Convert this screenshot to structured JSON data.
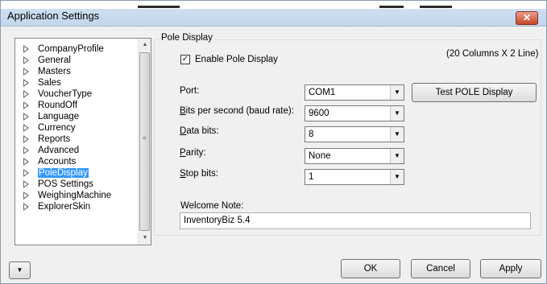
{
  "window": {
    "title": "Application Settings",
    "close_label": "✕"
  },
  "nav": {
    "items": [
      {
        "label": "CompanyProfile"
      },
      {
        "label": "General"
      },
      {
        "label": "Masters"
      },
      {
        "label": "Sales"
      },
      {
        "label": "VoucherType"
      },
      {
        "label": "RoundOff"
      },
      {
        "label": "Language"
      },
      {
        "label": "Currency"
      },
      {
        "label": "Reports"
      },
      {
        "label": "Advanced"
      },
      {
        "label": "Accounts"
      },
      {
        "label": "PoleDisplay",
        "selected": true
      },
      {
        "label": "POS Settings"
      },
      {
        "label": "WeighingMachine"
      },
      {
        "label": "ExplorerSkin"
      }
    ]
  },
  "pole_display": {
    "group_title": "Pole Display",
    "enable_label": "Enable Pole Display",
    "enable_checked": "✓",
    "columns_note": "(20 Columns X 2 Line)",
    "port_label": "Port:",
    "port_value": "COM1",
    "test_button": "Test POLE Display",
    "bps_label_u": "B",
    "bps_label_rest": "its per second (baud rate):",
    "bps_value": "9600",
    "databits_label_u": "D",
    "databits_label_rest": "ata bits:",
    "databits_value": "8",
    "parity_label_u": "P",
    "parity_label_rest": "arity:",
    "parity_value": "None",
    "stopbits_label_u": "S",
    "stopbits_label_rest": "top bits:",
    "stopbits_value": "1",
    "welcome_label": "Welcome Note:",
    "welcome_value": "InventoryBiz 5.4"
  },
  "footer": {
    "ok": "OK",
    "cancel": "Cancel",
    "apply": "Apply"
  },
  "colors": {
    "selection": "#3399ff",
    "close_button": "#c6452b",
    "titlebar": "#c3d6ec"
  }
}
